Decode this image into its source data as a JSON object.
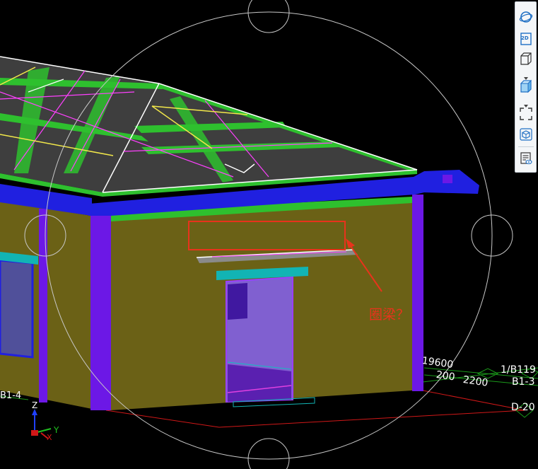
{
  "annotation": {
    "text": "圈梁？",
    "color": "#e8331c"
  },
  "dimensions": {
    "top": "19600",
    "left": "200",
    "right": "2200"
  },
  "axis_labels": {
    "b1_top": "1/B1",
    "b1_top_suffix": "19",
    "b1_mid": "B1-3",
    "d20": "D-20",
    "left_label": "B1-4"
  },
  "triad": {
    "z": "Z",
    "y": "Y",
    "x": "X"
  },
  "toolbar": {
    "btn_2d": "2D"
  },
  "colors": {
    "wall": "#6b6116",
    "column": "#6c18e6",
    "beam_blue": "#2020e0",
    "green_edge": "#2ec02e",
    "roof": "#3e3e3e",
    "magenta_line": "#ff40ff",
    "yellow_line": "#f2e84a",
    "cyan": "#12b4b4",
    "dim_green": "#1a9a1a",
    "red_line": "#d01818"
  }
}
